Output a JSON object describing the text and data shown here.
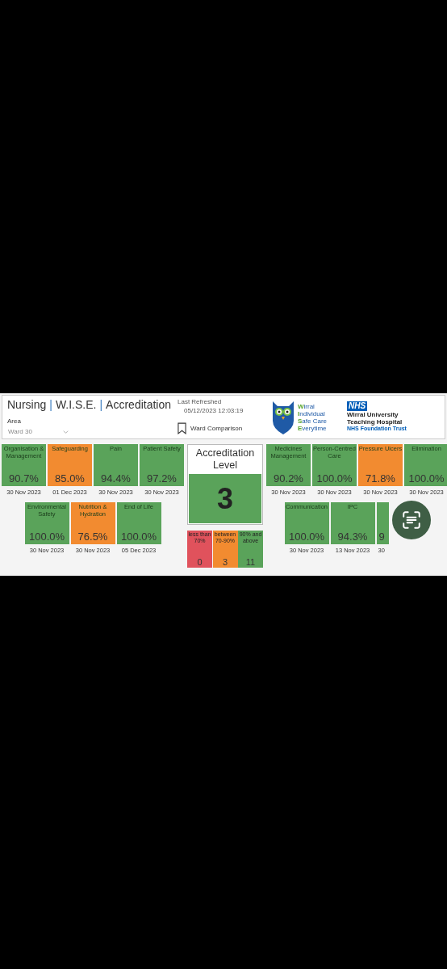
{
  "header": {
    "title": [
      "Nursing",
      "|",
      "W.I.S.E.",
      "|",
      "Accreditation"
    ],
    "area": {
      "label": "Area",
      "value": "Ward 30"
    },
    "refreshed": {
      "label": "Last Refreshed",
      "value": "05/12/2023 12:03:19"
    },
    "bookmark": {
      "label": "Ward Comparison"
    },
    "wise_logo": [
      {
        "initial": "W",
        "rest": "irral"
      },
      {
        "initial": "I",
        "rest": "ndividual"
      },
      {
        "initial": "S",
        "rest": "afe Care"
      },
      {
        "initial": "E",
        "rest": "verytime"
      }
    ],
    "nhs_logo": {
      "badge": "NHS",
      "lines": [
        "Wirral University",
        "Teaching Hospital"
      ],
      "trust": "NHS Foundation Trust"
    }
  },
  "left_tiles": [
    [
      {
        "kind": "full",
        "label": "Organisation & Management",
        "value": "90.7%",
        "date": "30 Nov 2023",
        "color": "#5aa35a"
      },
      {
        "kind": "full",
        "label": "Safeguarding",
        "value": "85.0%",
        "date": "01 Dec 2023",
        "color": "#f28b30"
      },
      {
        "kind": "full",
        "label": "Pain",
        "value": "94.4%",
        "date": "30 Nov 2023",
        "color": "#5aa35a"
      },
      {
        "kind": "full",
        "label": "Patient Safety",
        "value": "97.2%",
        "date": "30 Nov 2023",
        "color": "#5aa35a"
      }
    ],
    [
      {
        "kind": "full",
        "label": "Environmental Safety",
        "value": "100.0%",
        "date": "30 Nov 2023",
        "color": "#5aa35a"
      },
      {
        "kind": "full",
        "label": "Nutrition & Hydration",
        "value": "76.5%",
        "date": "30 Nov 2023",
        "color": "#f28b30"
      },
      {
        "kind": "full",
        "label": "End of Life",
        "value": "100.0%",
        "date": "05 Dec 2023",
        "color": "#5aa35a"
      }
    ]
  ],
  "accreditation": {
    "title": "Accreditation Level",
    "level_value": "3",
    "bands": [
      {
        "label": "less than 70%",
        "count": "0",
        "color": "#e0525c"
      },
      {
        "label": "between 70-90%",
        "count": "3",
        "color": "#f28b30"
      },
      {
        "label": "90% and above",
        "count": "11",
        "color": "#5aa35a"
      }
    ]
  },
  "right_tiles": [
    [
      {
        "kind": "full",
        "label": "Medicines Management",
        "value": "90.2%",
        "date": "30 Nov 2023",
        "color": "#5aa35a"
      },
      {
        "kind": "full",
        "label": "Person-Centred Care",
        "value": "100.0%",
        "date": "30 Nov 2023",
        "color": "#5aa35a"
      },
      {
        "kind": "full",
        "label": "Pressure Ulcers",
        "value": "71.8%",
        "date": "30 Nov 2023",
        "color": "#f28b30"
      },
      {
        "kind": "full",
        "label": "Elimination",
        "value": "100.0%",
        "date": "30 Nov 2023",
        "color": "#5aa35a"
      }
    ],
    [
      {
        "kind": "full",
        "label": "Communication",
        "value": "100.0%",
        "date": "30 Nov 2023",
        "color": "#5aa35a"
      },
      {
        "kind": "full",
        "label": "IPC",
        "value": "94.3%",
        "date": "13 Nov 2023",
        "color": "#5aa35a"
      },
      {
        "kind": "partial",
        "value": "9",
        "date": "30",
        "color": "#5aa35a"
      }
    ]
  ]
}
